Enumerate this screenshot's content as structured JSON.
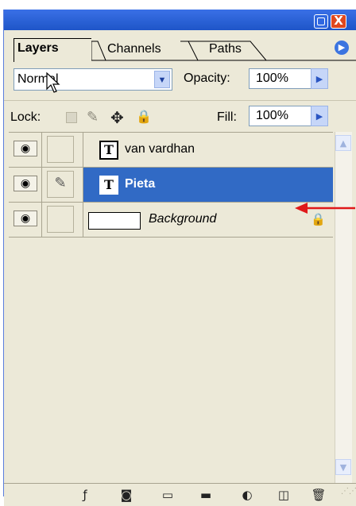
{
  "window": {
    "minimize_icon": "minimize-icon",
    "close_glyph": "X"
  },
  "tabs": [
    {
      "label": "Layers",
      "active": true
    },
    {
      "label": "Channels",
      "active": false
    },
    {
      "label": "Paths",
      "active": false
    }
  ],
  "blend": {
    "mode": "Normal",
    "opacity_label": "Opacity:",
    "opacity_value": "100%"
  },
  "lock": {
    "label": "Lock:",
    "fill_label": "Fill:",
    "fill_value": "100%"
  },
  "layers": [
    {
      "name": "van vardhan",
      "type": "text",
      "visible": true,
      "selected": false
    },
    {
      "name": "Pieta",
      "type": "text",
      "visible": true,
      "selected": true
    },
    {
      "name": "Background",
      "type": "raster",
      "visible": true,
      "selected": false,
      "locked": true
    }
  ],
  "colors": {
    "panel_bg": "#ece9d8",
    "selection": "#316ac5",
    "title_bar": "#1e55c8",
    "annotation_arrow": "#e0191a"
  },
  "toolbar_icons": [
    "layer-style-icon",
    "mask-icon",
    "group-folder-icon",
    "adjustment-layer-icon",
    "new-layer-icon",
    "trash-icon"
  ]
}
